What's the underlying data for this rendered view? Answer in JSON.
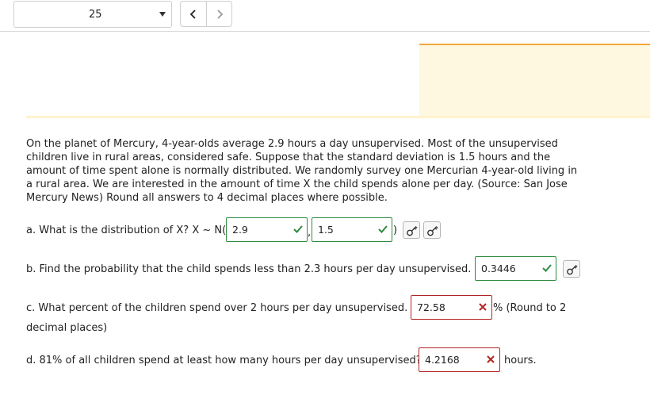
{
  "toolbar": {
    "page_select_value": "25",
    "prev_icon": "chevron-left-icon",
    "next_icon": "chevron-right-icon"
  },
  "problem": {
    "text": "On the planet of Mercury, 4-year-olds average 2.9 hours a day unsupervised. Most of the unsupervised children live in rural areas, considered safe. Suppose that the standard deviation is 1.5 hours and the amount of time spent alone is normally distributed. We randomly survey one Mercurian 4-year-old living in a rural area. We are interested in the amount of time X the child spends alone per day. (Source: San Jose Mercury News) Round all answers to 4 decimal places where possible."
  },
  "part_a": {
    "prefix": "a. What is the distribution of X? X ~ N(",
    "mean_value": "2.9",
    "separator": ",",
    "sd_value": "1.5",
    "suffix": ")",
    "mean_status": "correct",
    "sd_status": "correct"
  },
  "part_b": {
    "question": "b. Find the probability that the child spends less than 2.3 hours per day unsupervised.",
    "value": "0.3446",
    "status": "correct"
  },
  "part_c": {
    "question": "c. What percent of the children spend over 2 hours per day unsupervised.",
    "value": "72.58",
    "status": "incorrect",
    "suffix": "% (Round to 2",
    "suffix_line2": "decimal places)"
  },
  "part_d": {
    "question": "d. 81% of all children spend at least how many hours per day unsupervised?",
    "value": "4.2168",
    "status": "incorrect",
    "suffix": "hours."
  },
  "colors": {
    "correct": "#2e8b3e",
    "incorrect": "#b52424",
    "accent_orange": "#f2a63c",
    "panel_yellow": "#fff8e1"
  }
}
